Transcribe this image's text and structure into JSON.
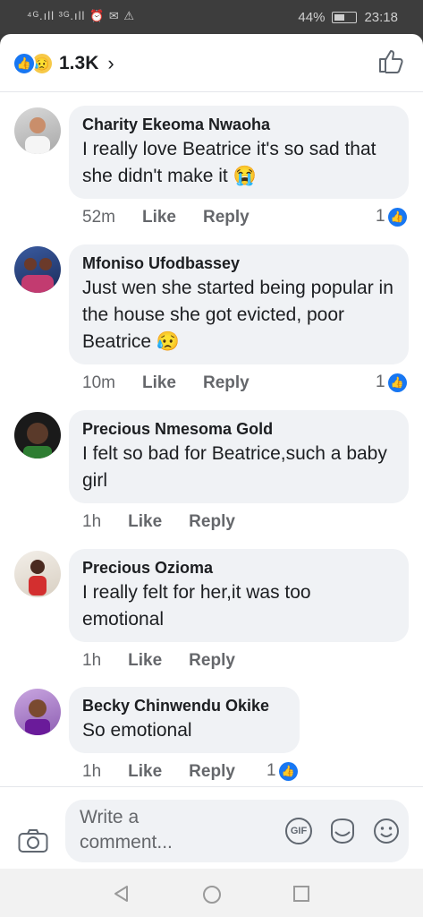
{
  "status": {
    "signal": "⁴ᴳ.ıll ³ᴳ.ıll ⏰ ✉ ⚠",
    "battery": "44%",
    "time": "23:18"
  },
  "header": {
    "reaction_count": "1.3K",
    "chevron": "›"
  },
  "comments": [
    {
      "author": "Charity Ekeoma Nwaoha",
      "text": "I really love Beatrice it's so sad that she didn't make it 😭",
      "time": "52m",
      "like": "Like",
      "reply": "Reply",
      "likes": "1"
    },
    {
      "author": "Mfoniso Ufodbassey",
      "text": "Just wen she started being popular in the house she got evicted, poor Beatrice 😥",
      "time": "10m",
      "like": "Like",
      "reply": "Reply",
      "likes": "1"
    },
    {
      "author": "Precious Nmesoma Gold",
      "text": "I felt so bad for Beatrice,such a baby girl",
      "time": "1h",
      "like": "Like",
      "reply": "Reply"
    },
    {
      "author": "Precious Ozioma",
      "text": "I really felt for her,it was too emotional",
      "time": "1h",
      "like": "Like",
      "reply": "Reply"
    },
    {
      "author": "Becky Chinwendu Okike",
      "text": "So emotional",
      "time": "1h",
      "like": "Like",
      "reply": "Reply",
      "likes": "1"
    }
  ],
  "composer": {
    "placeholder": "Write a comment...",
    "gif_label": "GIF"
  },
  "colors": {
    "accent": "#1877f2",
    "bubble": "#f0f2f5",
    "meta": "#65676b"
  },
  "icons": [
    "like-reaction-icon",
    "sad-reaction-icon",
    "thumbs-up-icon",
    "camera-icon",
    "gif-icon",
    "sticker-icon",
    "emoji-icon",
    "back-icon",
    "home-icon",
    "recents-icon"
  ]
}
